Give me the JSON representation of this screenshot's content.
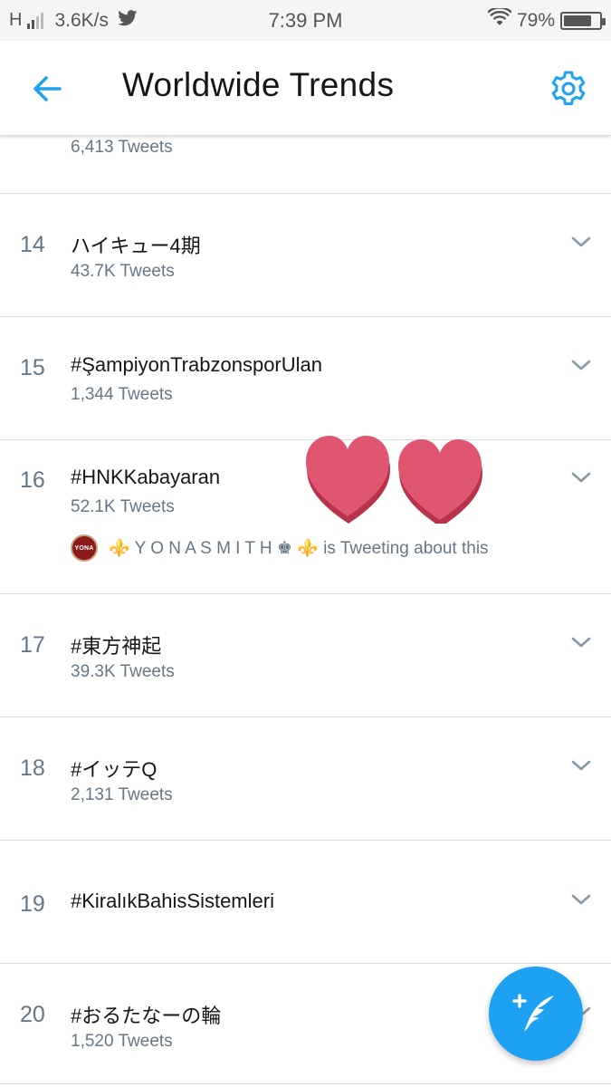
{
  "status_bar": {
    "network_type": "H",
    "speed": "3.6K/s",
    "time": "7:39 PM",
    "battery_percent": "79%",
    "battery_level": 0.79,
    "icons": [
      "signal-icon",
      "twitter-bird-icon",
      "wifi-icon",
      "battery-icon"
    ]
  },
  "header": {
    "title": "Worldwide Trends",
    "back_icon": "arrow-left-icon",
    "settings_icon": "gear-icon"
  },
  "trends": {
    "partial_top": {
      "meta": "6,413 Tweets"
    },
    "items": [
      {
        "rank": "14",
        "name": "ハイキュー4期",
        "meta": "43.7K Tweets"
      },
      {
        "rank": "15",
        "name": "#ŞampiyonTrabzonsporUlan",
        "meta": "1,344 Tweets"
      },
      {
        "rank": "16",
        "name": "#HNKKabayaran",
        "meta": "52.1K Tweets",
        "context": {
          "avatar_text": "YONA",
          "text": "⚜️ Y O N A S M I T H ♚ ⚜️ is Tweeting about this"
        }
      },
      {
        "rank": "17",
        "name": "#東方神起",
        "meta": "39.3K Tweets"
      },
      {
        "rank": "18",
        "name": "#イッテQ",
        "meta": "2,131 Tweets"
      },
      {
        "rank": "19",
        "name": "#KiralıkBahisSistemleri",
        "meta": ""
      },
      {
        "rank": "20",
        "name": "#おるたなーの輪",
        "meta": "1,520 Tweets"
      }
    ]
  },
  "fab": {
    "icon": "compose-tweet-icon"
  },
  "colors": {
    "accent": "#1da1f2",
    "secondary_text": "#657786",
    "primary_text": "#14171a",
    "divider": "#d8dde1",
    "heart": "#e05570"
  }
}
